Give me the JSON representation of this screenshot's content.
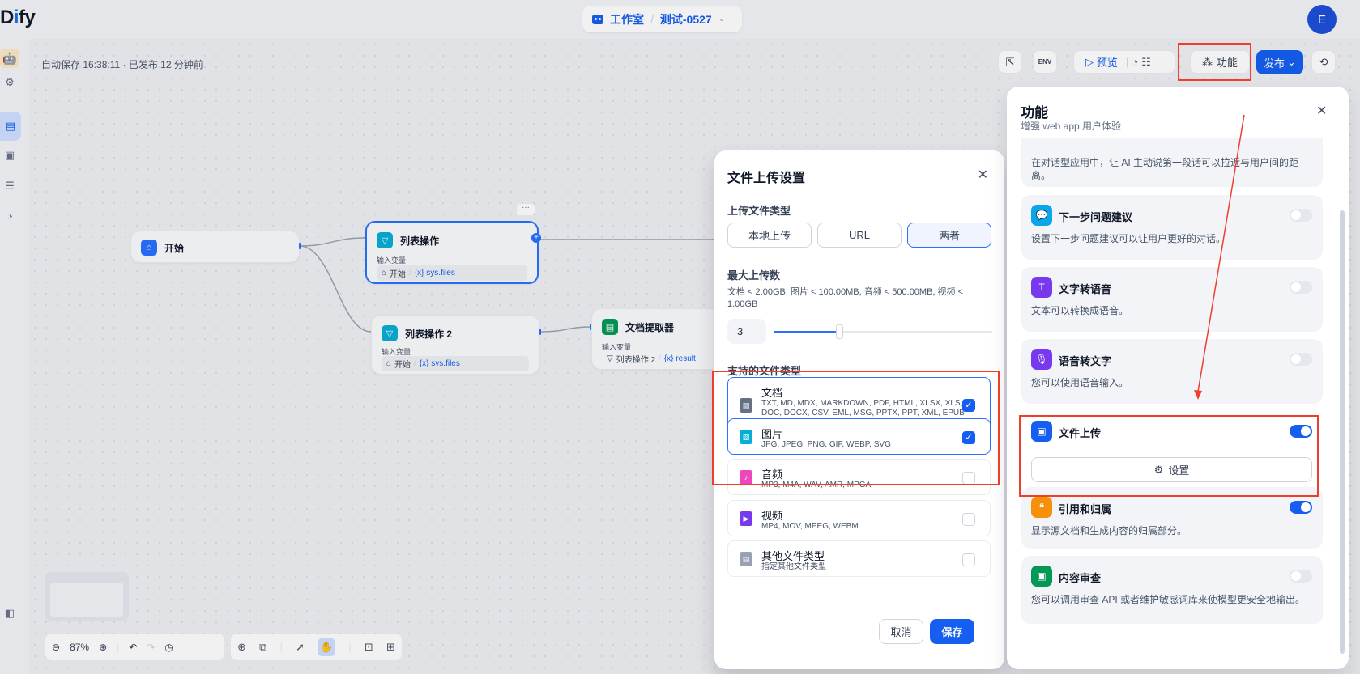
{
  "brand": {
    "logo": "Dify"
  },
  "header": {
    "workspace": "工作室",
    "app_name": "测试-0527",
    "avatar_letter": "E"
  },
  "status": {
    "autosave": "自动保存 16:38:11 · 已发布 12 分钟前"
  },
  "toolbar": {
    "preview": "预览",
    "features": "功能",
    "publish": "发布"
  },
  "nodes": {
    "start": {
      "title": "开始"
    },
    "list_op_1": {
      "title": "列表操作",
      "input_label": "输入变量",
      "var_node": "开始",
      "var_name": "sys.files"
    },
    "list_op_2": {
      "title": "列表操作 2",
      "input_label": "输入变量",
      "var_node": "开始",
      "var_name": "sys.files"
    },
    "doc_extractor": {
      "title": "文档提取器",
      "input_label": "输入变量",
      "var_node": "列表操作 2",
      "var_name": "result"
    }
  },
  "zoom": {
    "level": "87%"
  },
  "upload_modal": {
    "title": "文件上传设置",
    "type_label": "上传文件类型",
    "methods": [
      "本地上传",
      "URL",
      "两者"
    ],
    "selected_method": "两者",
    "max_label": "最大上传数",
    "limits_note": "文档 < 2.00GB, 图片 < 100.00MB, 音频 < 500.00MB, 视频 < 1.00GB",
    "max_value": "3",
    "max_fraction": 0.3,
    "supported_label": "支持的文件类型",
    "file_types": [
      {
        "name": "文档",
        "ext": "TXT, MD, MDX, MARKDOWN, PDF, HTML, XLSX, XLS, DOC, DOCX, CSV, EML, MSG, PPTX, PPT, XML, EPUB",
        "checked": true
      },
      {
        "name": "图片",
        "ext": "JPG, JPEG, PNG, GIF, WEBP, SVG",
        "checked": true
      },
      {
        "name": "音频",
        "ext": "MP3, M4A, WAV, AMR, MPGA",
        "checked": false
      },
      {
        "name": "视频",
        "ext": "MP4, MOV, MPEG, WEBM",
        "checked": false
      },
      {
        "name": "其他文件类型",
        "ext": "指定其他文件类型",
        "checked": false
      }
    ],
    "cancel": "取消",
    "save": "保存"
  },
  "features_panel": {
    "title": "功能",
    "subtitle": "增强 web app 用户体验",
    "opener_desc": "在对话型应用中，让 AI 主动说第一段话可以拉近与用户间的距离。",
    "items": [
      {
        "name": "下一步问题建议",
        "desc": "设置下一步问题建议可以让用户更好的对话。",
        "enabled": false,
        "color": "#0ba5ec"
      },
      {
        "name": "文字转语音",
        "desc": "文本可以转换成语音。",
        "enabled": false,
        "color": "#7839ee"
      },
      {
        "name": "语音转文字",
        "desc": "您可以使用语音输入。",
        "enabled": false,
        "color": "#7839ee"
      },
      {
        "name": "文件上传",
        "desc": "",
        "enabled": true,
        "color": "#155eef",
        "settings_label": "设置"
      },
      {
        "name": "引用和归属",
        "desc": "显示源文档和生成内容的归属部分。",
        "enabled": true,
        "color": "#f79009"
      },
      {
        "name": "内容审查",
        "desc": "您可以调用审查 API 或者维护敏感词库来使模型更安全地输出。",
        "enabled": false,
        "color": "#039855"
      }
    ]
  },
  "colors": {
    "accent": "#155eef",
    "annotation": "#ef3d2e"
  }
}
